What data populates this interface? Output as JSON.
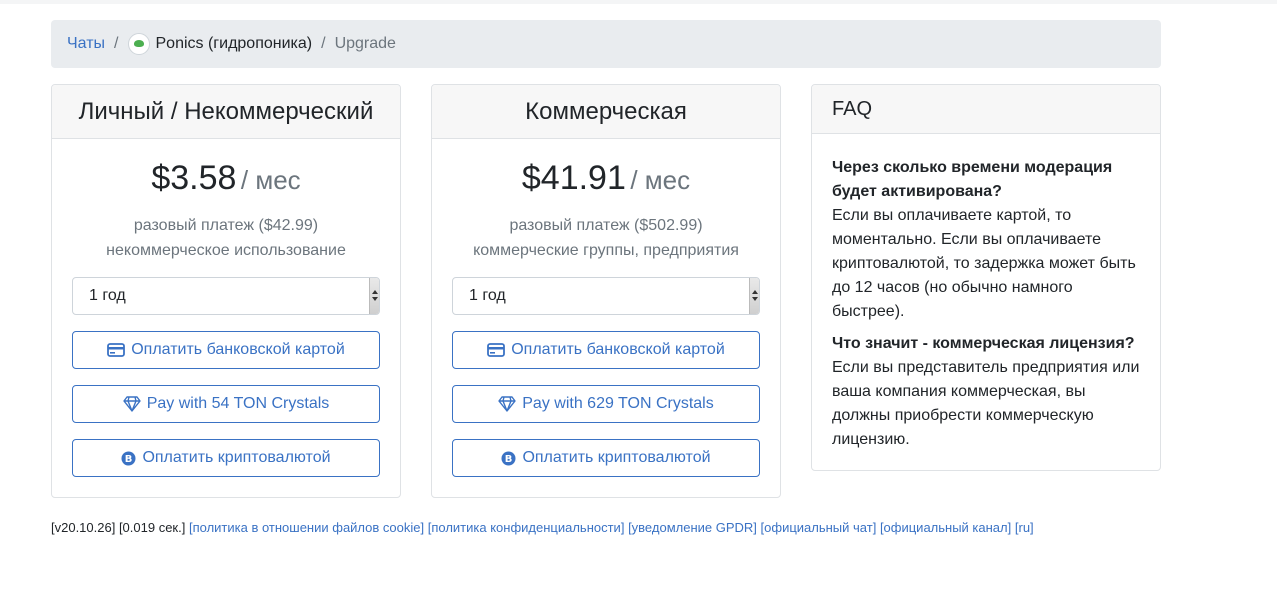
{
  "breadcrumb": {
    "chats": "Чаты",
    "separator": "/",
    "chat_name": "Ponics (гидропоника)",
    "current": "Upgrade"
  },
  "plans": [
    {
      "title": "Личный / Некоммерческий",
      "price": "$3.58",
      "per": "/ мес",
      "one_time": "разовый платеж ($42.99)",
      "usage": "некоммерческое использование",
      "period": "1 год",
      "pay_card": "Оплатить банковской картой",
      "pay_ton": "Pay with 54 TON Crystals",
      "pay_crypto": "Оплатить криптовалютой"
    },
    {
      "title": "Коммерческая",
      "price": "$41.91",
      "per": "/ мес",
      "one_time": "разовый платеж ($502.99)",
      "usage": "коммерческие группы, предприятия",
      "period": "1 год",
      "pay_card": "Оплатить банковской картой",
      "pay_ton": "Pay with 629 TON Crystals",
      "pay_crypto": "Оплатить криптовалютой"
    }
  ],
  "faq": {
    "title": "FAQ",
    "items": [
      {
        "q": "Через сколько времени модерация будет активирована?",
        "a": "Если вы оплачиваете картой, то моментально. Если вы оплачиваете криптовалютой, то задержка может быть до 12 часов (но обычно намного быстрее)."
      },
      {
        "q": "Что значит - коммерческая лицензия?",
        "a": "Если вы представитель предприятия или ваша компания коммерческая, вы должны приобрести коммерческую лицензию."
      }
    ]
  },
  "footer": {
    "version": "[v20.10.26] [0.019 сек.]",
    "links": [
      "[политика в отношении файлов cookie]",
      "[политика конфиденциальности]",
      "[уведомление GPDR]",
      "[официальный чат]",
      "[официальный канал]",
      "[ru]"
    ]
  },
  "icons": {
    "chat_logo": "ponics-logo-icon",
    "card": "credit-card-icon",
    "ton": "diamond-icon",
    "crypto": "bitcoin-icon"
  },
  "colors": {
    "link": "#3a72c4",
    "muted": "#6c757d",
    "breadcrumb_bg": "#e9ecef"
  }
}
